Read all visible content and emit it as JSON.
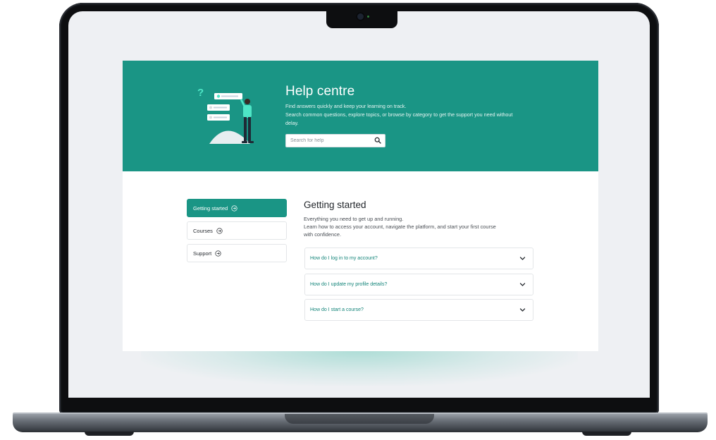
{
  "hero": {
    "title": "Help centre",
    "subtitle_line1": "Find answers quickly and keep your learning on track.",
    "subtitle_line2": "Search common questions, explore topics, or browse by category to get the support you need without",
    "subtitle_line3": "delay.",
    "search_placeholder": "Search for help",
    "search_icon": "search-icon",
    "color": "#1a9585"
  },
  "sidebar": {
    "items": [
      {
        "label": "Getting started",
        "active": true,
        "icon": "arrow-right-circle-icon"
      },
      {
        "label": "Courses",
        "active": false,
        "icon": "arrow-right-circle-icon"
      },
      {
        "label": "Support",
        "active": false,
        "icon": "arrow-right-circle-icon"
      }
    ]
  },
  "content": {
    "title": "Getting started",
    "desc_line1": "Everything you need to get up and running.",
    "desc_line2": " Learn how to access your account, navigate the platform, and start your first course",
    "desc_line3": "with confidence.",
    "faqs": [
      {
        "question": "How do I log in to my account?",
        "icon": "chevron-down-icon"
      },
      {
        "question": "How do I update my profile details?",
        "icon": "chevron-down-icon"
      },
      {
        "question": "How do I start a course?",
        "icon": "chevron-down-icon"
      }
    ]
  },
  "colors": {
    "accent": "#1a9585",
    "faq_text": "#15857a",
    "laptop_bezel": "#0d0e10",
    "screen_bg": "#eef0f3"
  }
}
